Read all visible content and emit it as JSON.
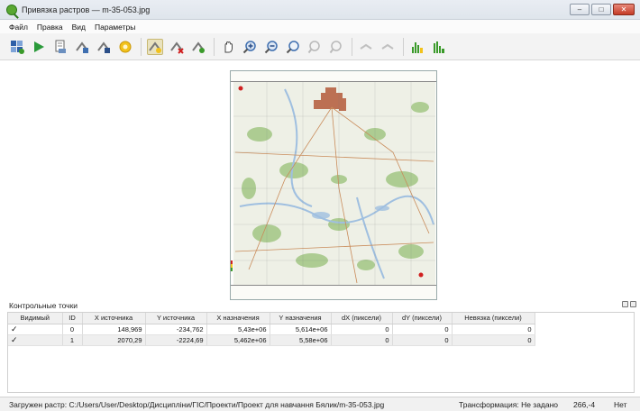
{
  "window": {
    "title": "Привязка растров — m-35-053.jpg",
    "buttons": {
      "minimize": "–",
      "maximize": "□",
      "close": "✕"
    }
  },
  "menu": [
    "Файл",
    "Правка",
    "Вид",
    "Параметры"
  ],
  "toolbar_icons": [
    "open-raster-icon",
    "start-georeferencing-icon",
    "generate-gdal-script-icon",
    "load-gcp-points-icon",
    "save-gcp-points-icon",
    "transformation-settings-icon",
    "add-point-icon",
    "delete-point-icon",
    "move-gcp-point-icon",
    "pan-icon",
    "zoom-in-icon",
    "zoom-out-icon",
    "zoom-to-layer-icon",
    "zoom-last-icon",
    "zoom-next-icon",
    "link-georef-to-qgis-icon",
    "link-qgis-to-georef-icon",
    "local-histogram-stretch-icon",
    "full-histogram-stretch-icon"
  ],
  "colors": {
    "map_green": "#a6c98a",
    "map_city": "#b45a3a",
    "map_water": "#9fbfe0",
    "gcp_red": "#d02020"
  },
  "dock": {
    "title": "Контрольные точки",
    "columns": [
      "Видимый",
      "ID",
      "X источника",
      "Y источника",
      "X назначения",
      "Y назначения",
      "dX (пиксели)",
      "dY (пиксели)",
      "Невязка (пиксели)"
    ],
    "rows": [
      {
        "visible": "✓",
        "id": "0",
        "src_x": "148,969",
        "src_y": "-234,762",
        "dst_x": "5,43e+06",
        "dst_y": "5,614e+06",
        "dx": "0",
        "dy": "0",
        "residual": "0"
      },
      {
        "visible": "✓",
        "id": "1",
        "src_x": "2070,29",
        "src_y": "-2224,69",
        "dst_x": "5,462e+06",
        "dst_y": "5,58e+06",
        "dx": "0",
        "dy": "0",
        "residual": "0"
      }
    ]
  },
  "status": {
    "message": "Загружен растр: C:/Users/User/Desktop/Дисципліни/ГІС/Проекти/Проект для навчання Бялик/m-35-053.jpg",
    "transformation": "Трансформация: Не задано",
    "coordinates": "266,-4",
    "crs": "Нет"
  }
}
